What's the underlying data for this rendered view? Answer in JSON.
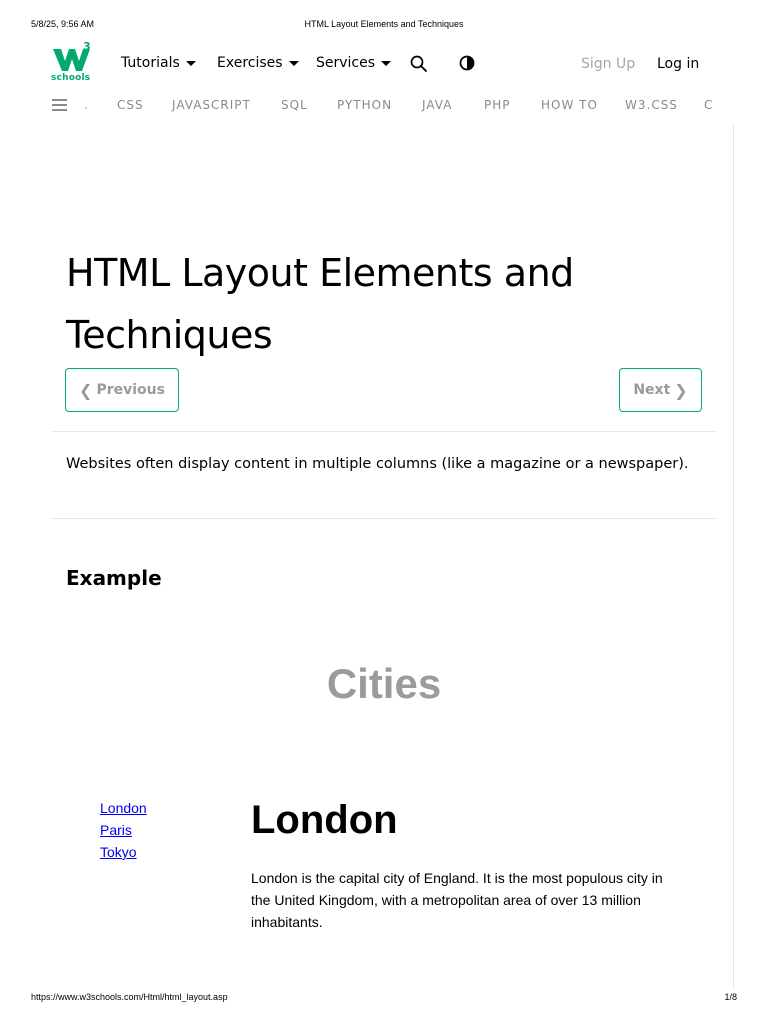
{
  "print": {
    "datetime": "5/8/25, 9:56 AM",
    "doc_title": "HTML Layout Elements and Techniques",
    "url": "https://www.w3schools.com/Html/html_layout.asp",
    "page": "1/8"
  },
  "topbar": {
    "logo_text": "schools",
    "logo_sup": "3",
    "menus": [
      "Tutorials",
      "Exercises",
      "Services"
    ],
    "signup": "Sign Up",
    "login": "Log in",
    "search_icon": "search-icon",
    "contrast_icon": "contrast-icon"
  },
  "subnav": {
    "items": [
      ".",
      "CSS",
      "JAVASCRIPT",
      "SQL",
      "PYTHON",
      "JAVA",
      "PHP",
      "HOW TO",
      "W3.CSS",
      "C"
    ]
  },
  "article": {
    "title_line1": "HTML Layout Elements and",
    "title_line2": "Techniques",
    "prev_label": "Previous",
    "next_label": "Next",
    "intro": "Websites often display content in multiple columns (like a magazine or a newspaper).",
    "example_heading": "Example"
  },
  "example": {
    "header": "Cities",
    "links": [
      "London",
      "Paris",
      "Tokyo"
    ],
    "city_title": "London",
    "city_text": "London is the capital city of England. It is the most populous city in the United Kingdom, with a metropolitan area of over 13 million inhabitants."
  },
  "colors": {
    "brand": "#04AA6D",
    "link": "#0000EE",
    "muted": "#8a8a8a"
  }
}
